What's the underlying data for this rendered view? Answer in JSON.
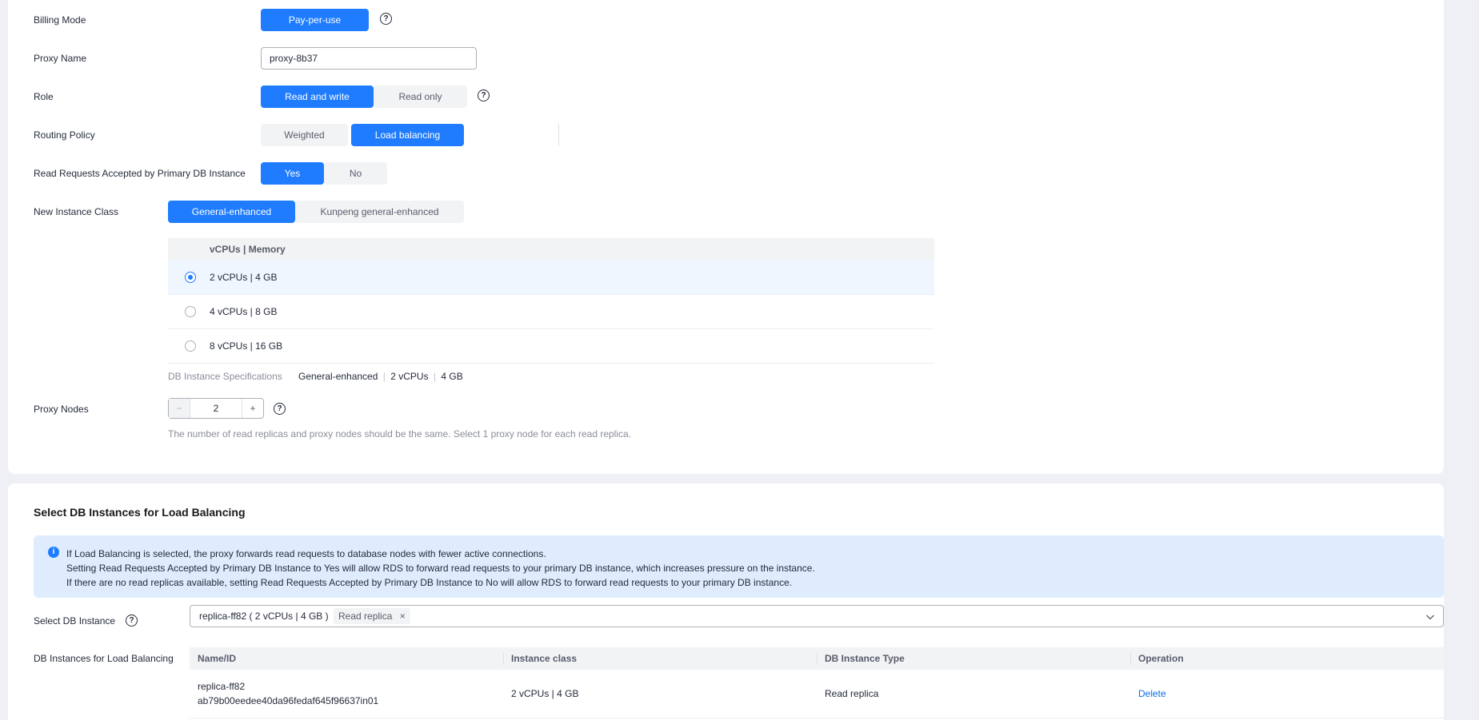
{
  "form": {
    "billing_mode": {
      "label": "Billing Mode",
      "value": "Pay-per-use"
    },
    "proxy_name": {
      "label": "Proxy Name",
      "value": "proxy-8b37"
    },
    "role": {
      "label": "Role",
      "options": [
        "Read and write",
        "Read only"
      ],
      "selected": "Read and write"
    },
    "routing_policy": {
      "label": "Routing Policy",
      "options": [
        "Weighted",
        "Load balancing"
      ],
      "selected": "Load balancing"
    },
    "read_requests": {
      "label": "Read Requests Accepted by Primary DB Instance",
      "options": [
        "Yes",
        "No"
      ],
      "selected": "Yes"
    },
    "instance_class": {
      "label": "New Instance Class",
      "options": [
        "General-enhanced",
        "Kunpeng general-enhanced"
      ],
      "selected": "General-enhanced"
    },
    "spec_table": {
      "header": "vCPUs | Memory",
      "rows": [
        "2 vCPUs | 4 GB",
        "4 vCPUs | 8 GB",
        "8 vCPUs | 16 GB"
      ],
      "selected_index": 0
    },
    "db_spec": {
      "label": "DB Instance Specifications",
      "class": "General-enhanced",
      "vcpus": "2 vCPUs",
      "memory": "4 GB"
    },
    "proxy_nodes": {
      "label": "Proxy Nodes",
      "value": "2",
      "minus": "−",
      "plus": "+",
      "hint": "The number of read replicas and proxy nodes should be the same. Select 1 proxy node for each read replica."
    }
  },
  "lb_section": {
    "title": "Select DB Instances for Load Balancing",
    "info_lines": [
      "If Load Balancing is selected, the proxy forwards read requests to database nodes with fewer active connections.",
      "Setting Read Requests Accepted by Primary DB Instance to Yes will allow RDS to forward read requests to your primary DB instance, which increases pressure on the instance.",
      "If there are no read replicas available, setting Read Requests Accepted by Primary DB Instance to No will allow RDS to forward read requests to your primary DB instance."
    ],
    "select_label": "Select DB Instance",
    "selected_instance": {
      "text": "replica-ff82 ( 2 vCPUs | 4 GB )",
      "tag": "Read replica",
      "remove": "×"
    },
    "table_label": "DB Instances for Load Balancing",
    "columns": [
      "Name/ID",
      "Instance class",
      "DB Instance Type",
      "Operation"
    ],
    "rows": [
      {
        "name": "replica-ff82",
        "id": "ab79b00eedee40da96fedaf645f96637in01",
        "instance_class": "2 vCPUs | 4 GB",
        "type": "Read replica",
        "operation": "Delete"
      }
    ]
  },
  "icons": {
    "help": "question-circle-icon",
    "info": "info-circle-icon",
    "dropdown": "chevron-down-icon"
  },
  "colors": {
    "accent": "#1f7cff",
    "info_bg": "#deecfd",
    "link": "#0d6de8"
  }
}
